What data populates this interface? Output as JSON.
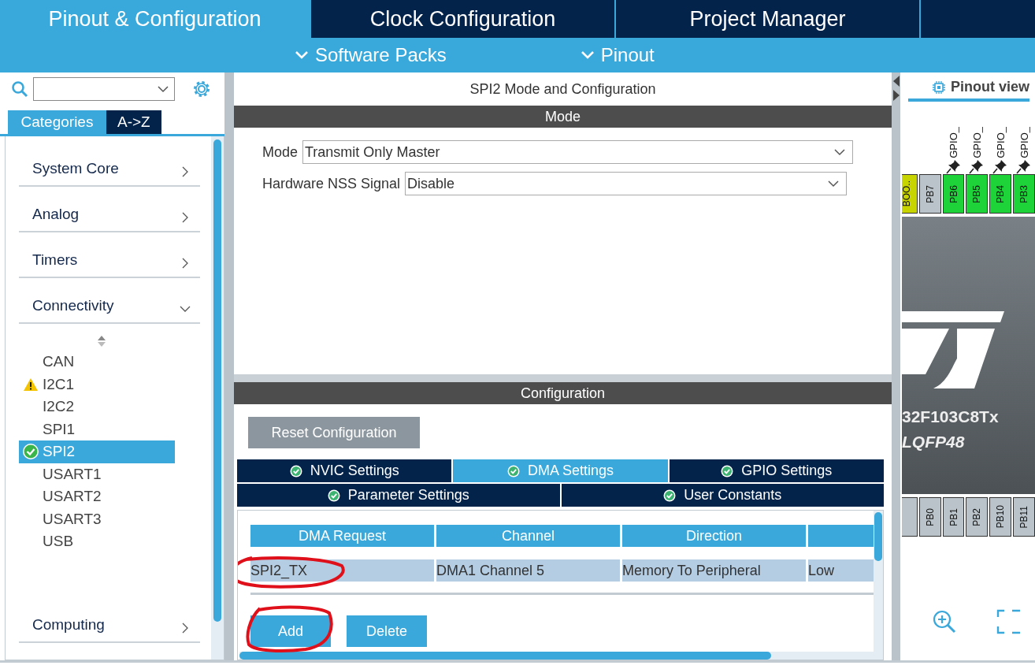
{
  "top_tabs": [
    {
      "label": "Pinout & Configuration",
      "selected": true
    },
    {
      "label": "Clock Configuration",
      "selected": false
    },
    {
      "label": "Project Manager",
      "selected": false
    }
  ],
  "sub_menus": [
    "Software Packs",
    "Pinout"
  ],
  "sidebar": {
    "view_tabs": [
      {
        "label": "Categories",
        "selected": true
      },
      {
        "label": "A->Z",
        "selected": false
      }
    ],
    "categories": [
      {
        "label": "System Core",
        "expanded": false
      },
      {
        "label": "Analog",
        "expanded": false
      },
      {
        "label": "Timers",
        "expanded": false
      },
      {
        "label": "Connectivity",
        "expanded": true,
        "children": [
          {
            "label": "CAN",
            "warning": false,
            "configured": false,
            "selected": false
          },
          {
            "label": "I2C1",
            "warning": true,
            "configured": false,
            "selected": false
          },
          {
            "label": "I2C2",
            "warning": false,
            "configured": false,
            "selected": false
          },
          {
            "label": "SPI1",
            "warning": false,
            "configured": false,
            "selected": false
          },
          {
            "label": "SPI2",
            "warning": false,
            "configured": true,
            "selected": true
          },
          {
            "label": "USART1",
            "warning": false,
            "configured": false,
            "selected": false
          },
          {
            "label": "USART2",
            "warning": false,
            "configured": false,
            "selected": false
          },
          {
            "label": "USART3",
            "warning": false,
            "configured": false,
            "selected": false
          },
          {
            "label": "USB",
            "warning": false,
            "configured": false,
            "selected": false
          }
        ]
      },
      {
        "label": "Computing",
        "expanded": false
      }
    ]
  },
  "main": {
    "title": "SPI2 Mode and Configuration",
    "mode_header": "Mode",
    "fields": [
      {
        "label": "Mode",
        "value": "Transmit Only Master"
      },
      {
        "label": "Hardware NSS Signal",
        "value": "Disable"
      }
    ],
    "config_header": "Configuration",
    "reset_button": "Reset Configuration",
    "config_tabs": [
      [
        {
          "label": "NVIC Settings",
          "selected": false
        },
        {
          "label": "DMA Settings",
          "selected": true
        },
        {
          "label": "GPIO Settings",
          "selected": false
        }
      ],
      [
        {
          "label": "Parameter Settings",
          "selected": false
        },
        {
          "label": "User Constants",
          "selected": false
        }
      ]
    ],
    "dma_table": {
      "columns": [
        "DMA Request",
        "Channel",
        "Direction"
      ],
      "rows": [
        {
          "cells": [
            "SPI2_TX",
            "DMA1 Channel 5",
            "Memory To Peripheral",
            "Low"
          ],
          "selected": true
        }
      ]
    },
    "buttons": [
      "Add",
      "Delete"
    ]
  },
  "pinout": {
    "title": "Pinout view",
    "top_pins": [
      {
        "label": "BOO..",
        "color": "#c8d400"
      },
      {
        "label": "PB7",
        "color": "#b9c3c9"
      },
      {
        "label": "PB6",
        "signal": "GPIO_",
        "color": "#1ed33a"
      },
      {
        "label": "PB5",
        "signal": "GPIO_",
        "color": "#1ed33a"
      },
      {
        "label": "PB4",
        "signal": "GPIO_",
        "color": "#1ed33a"
      },
      {
        "label": "PB3",
        "signal": "GPIO_",
        "color": "#1ed33a"
      }
    ],
    "chip_name": "32F103C8Tx",
    "package": "LQFP48",
    "bottom_pins": [
      {
        "label": "PB0",
        "color": "#b9c3c9"
      },
      {
        "label": "PB1",
        "color": "#b9c3c9"
      },
      {
        "label": "PB2",
        "color": "#b9c3c9"
      },
      {
        "label": "PB10",
        "color": "#b9c3c9"
      },
      {
        "label": "PB11",
        "color": "#b9c3c9"
      }
    ]
  }
}
